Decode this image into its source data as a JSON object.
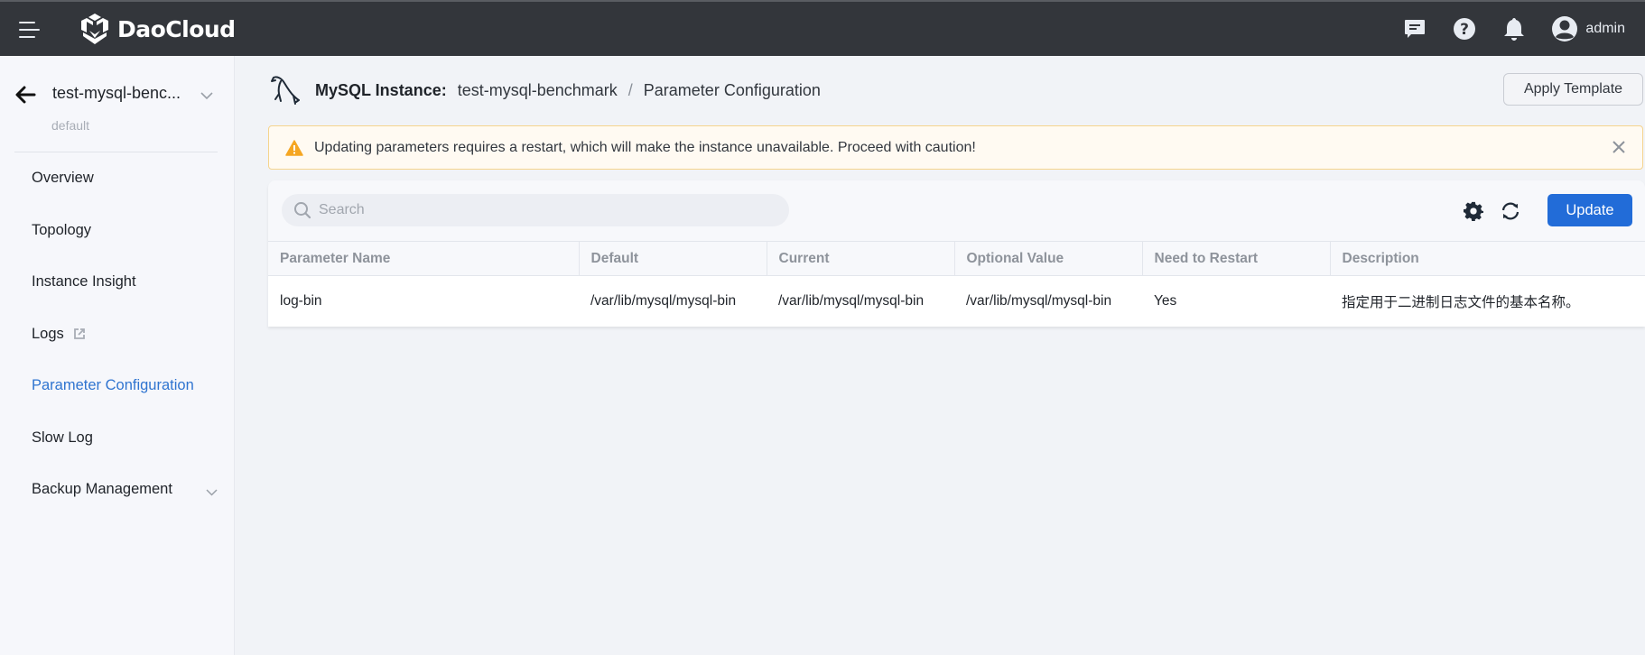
{
  "topbar": {
    "brand": "DaoCloud",
    "user_name": "admin",
    "icons": [
      "menu-icon",
      "chat-icon",
      "help-icon",
      "bell-icon",
      "user-avatar-icon"
    ]
  },
  "sidebar": {
    "instance_name": "test-mysql-benc...",
    "namespace": "default",
    "items": [
      {
        "label": "Overview",
        "active": false
      },
      {
        "label": "Topology",
        "active": false
      },
      {
        "label": "Instance Insight",
        "active": false
      },
      {
        "label": "Logs",
        "active": false,
        "external": true
      },
      {
        "label": "Parameter Configuration",
        "active": true
      },
      {
        "label": "Slow Log",
        "active": false
      },
      {
        "label": "Backup Management",
        "active": false,
        "expandable": true
      }
    ]
  },
  "header": {
    "title": "MySQL Instance:",
    "instance": "test-mysql-benchmark",
    "separator": "/",
    "page": "Parameter Configuration",
    "apply_template_label": "Apply Template"
  },
  "alert": {
    "text": "Updating parameters requires a restart, which will make the instance unavailable. Proceed with caution!"
  },
  "toolbar": {
    "search_placeholder": "Search",
    "update_label": "Update"
  },
  "table": {
    "columns": [
      "Parameter Name",
      "Default",
      "Current",
      "Optional Value",
      "Need to Restart",
      "Description"
    ],
    "rows": [
      [
        "log-bin",
        "/var/lib/mysql/mysql-bin",
        "/var/lib/mysql/mysql-bin",
        "/var/lib/mysql/mysql-bin",
        "Yes",
        "指定用于二进制日志文件的基本名称。"
      ]
    ]
  },
  "colors": {
    "primary": "#226cd8",
    "active_nav": "#2f74d0",
    "topbar_bg": "#33363b",
    "warning": "#f5a623"
  }
}
